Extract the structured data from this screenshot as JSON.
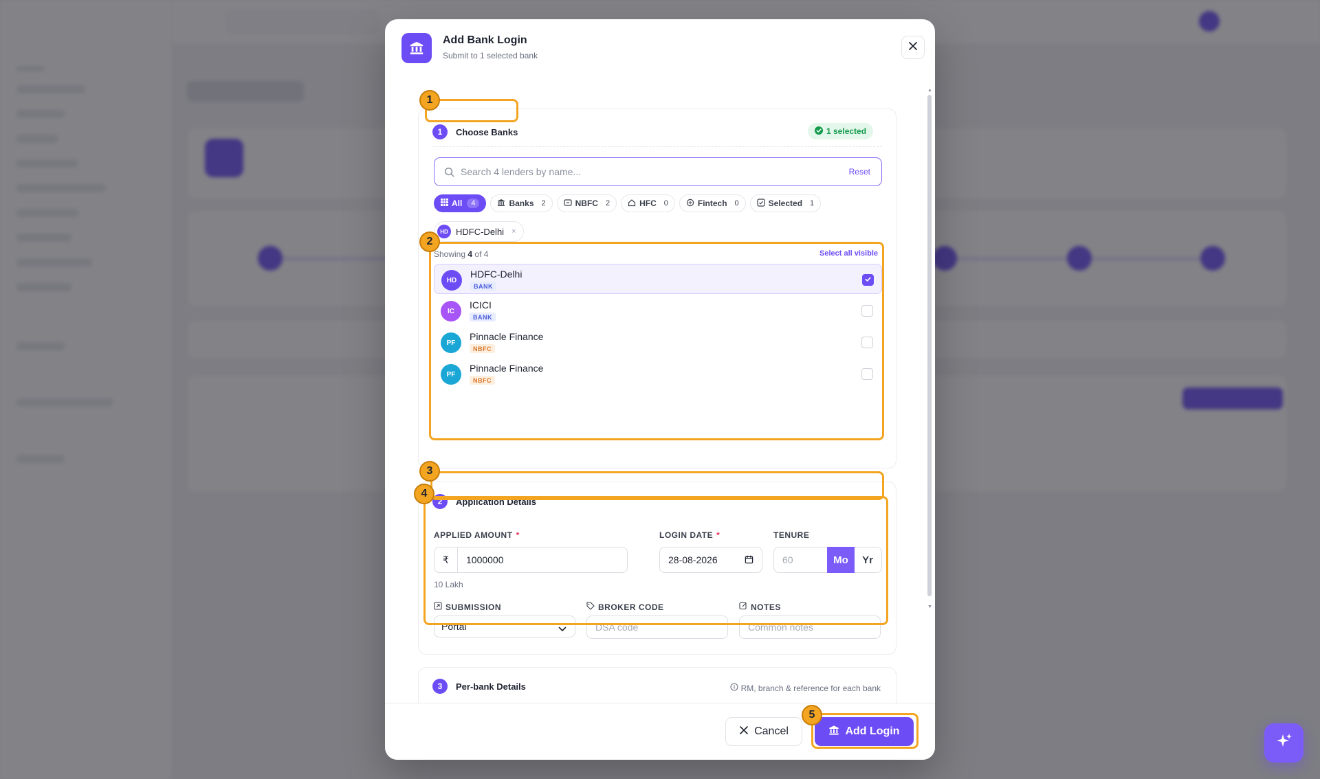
{
  "modal": {
    "title": "Add Bank Login",
    "subtitle": "Submit to 1 selected bank",
    "close_icon": "close-icon"
  },
  "step1": {
    "number": "1",
    "title": "Choose Banks",
    "selected_badge": "1 selected",
    "search": {
      "placeholder": "Search 4 lenders by name...",
      "value": ""
    },
    "reset_label": "Reset",
    "filters": [
      {
        "label": "All",
        "count": "4",
        "active": true,
        "icon": "grid-icon"
      },
      {
        "label": "Banks",
        "count": "2",
        "active": false,
        "icon": "bank-icon"
      },
      {
        "label": "NBFC",
        "count": "2",
        "active": false,
        "icon": "nbfc-icon"
      },
      {
        "label": "HFC",
        "count": "0",
        "active": false,
        "icon": "home-icon"
      },
      {
        "label": "Fintech",
        "count": "0",
        "active": false,
        "icon": "fintech-icon"
      },
      {
        "label": "Selected",
        "count": "1",
        "active": false,
        "icon": "checkbox-icon"
      }
    ],
    "selected_pill": {
      "initials": "HD",
      "name": "HDFC-Delhi",
      "remove": "×"
    },
    "showing_prefix": "Showing",
    "showing_count": "4",
    "showing_suffix": "of 4",
    "select_all_label": "Select all visible",
    "banks": [
      {
        "initials": "HD",
        "name": "HDFC-Delhi",
        "type": "BANK",
        "checked": true,
        "color": "#6c4cf5"
      },
      {
        "initials": "IC",
        "name": "ICICI",
        "type": "BANK",
        "checked": false,
        "color": "#a855f7"
      },
      {
        "initials": "PF",
        "name": "Pinnacle Finance",
        "type": "NBFC",
        "checked": false,
        "color": "#1aa7d6"
      },
      {
        "initials": "PF",
        "name": "Pinnacle Finance",
        "type": "NBFC",
        "checked": false,
        "color": "#1aa7d6"
      }
    ]
  },
  "step2": {
    "number": "2",
    "title": "Application Details",
    "applied_amount": {
      "label": "APPLIED AMOUNT",
      "required": "*",
      "prefix": "₹",
      "value": "1000000",
      "hint": "10 Lakh"
    },
    "login_date": {
      "label": "LOGIN DATE",
      "required": "*",
      "value": "28-08-2026"
    },
    "tenure": {
      "label": "TENURE",
      "placeholder": "60",
      "month_label": "Mo",
      "year_label": "Yr",
      "selected": "Mo"
    },
    "submission": {
      "label": "SUBMISSION",
      "value": "Portal"
    },
    "broker_code": {
      "label": "BROKER CODE",
      "placeholder": "DSA code"
    },
    "notes": {
      "label": "NOTES",
      "placeholder": "Common notes"
    }
  },
  "step3": {
    "number": "3",
    "title": "Per-bank Details",
    "note": "RM, branch & reference for each bank"
  },
  "footer": {
    "cancel_label": "Cancel",
    "add_label": "Add Login"
  },
  "annotations": [
    "1",
    "2",
    "3",
    "4",
    "5"
  ],
  "colors": {
    "accent": "#6c4cf5",
    "annotation": "#f3a521",
    "success": "#169b4d"
  }
}
